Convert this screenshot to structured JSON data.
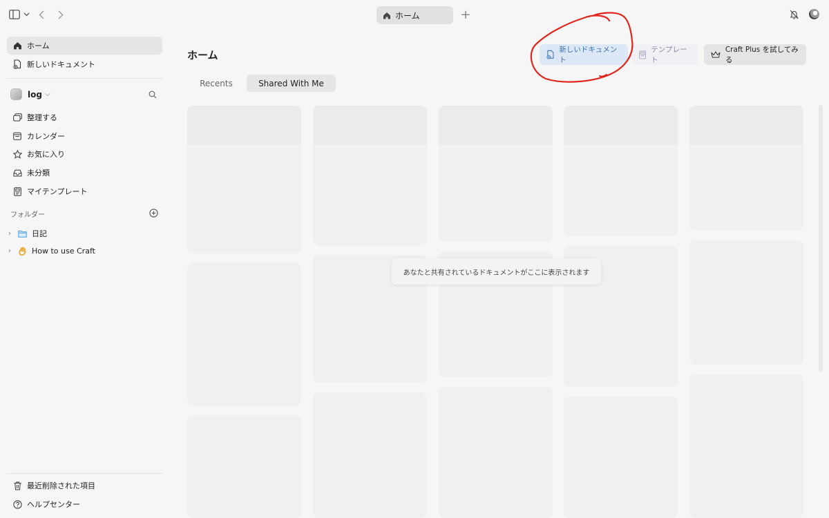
{
  "topbar": {
    "tab_label": "ホーム",
    "icons": [
      "sidebar-toggle-icon",
      "chevron-down-icon",
      "back-arrow-icon",
      "forward-arrow-icon",
      "house-icon",
      "plus-icon",
      "bell-slash-icon",
      "avatar"
    ]
  },
  "sidebar": {
    "top_items": [
      {
        "label": "ホーム",
        "icon": "house-icon",
        "active": true
      },
      {
        "label": "新しいドキュメント",
        "icon": "new-document-icon"
      }
    ],
    "workspace": {
      "name": "log"
    },
    "nav_items": [
      {
        "label": "整理する",
        "icon": "organize-icon"
      },
      {
        "label": "カレンダー",
        "icon": "calendar-icon"
      },
      {
        "label": "お気に入り",
        "icon": "star-icon"
      },
      {
        "label": "未分類",
        "icon": "inbox-icon"
      },
      {
        "label": "マイテンプレート",
        "icon": "template-icon"
      }
    ],
    "folders_label": "フォルダー",
    "folders": [
      {
        "label": "日記",
        "icon": "folder-icon"
      },
      {
        "label": "How to use Craft",
        "icon": "waving-hand-icon"
      }
    ],
    "bottom_items": [
      {
        "label": "最近削除された項目",
        "icon": "trash-icon"
      },
      {
        "label": "ヘルプセンター",
        "icon": "help-icon"
      }
    ]
  },
  "main": {
    "title": "ホーム",
    "buttons": {
      "new_document": "新しいドキュメント",
      "templates": "テンプレート",
      "craft_plus": "Craft Plus を試してみる"
    },
    "tabs": [
      {
        "label": "Recents",
        "active": false
      },
      {
        "label": "Shared With Me",
        "active": true
      }
    ],
    "empty_message": "あなたと共有されているドキュメントがここに表示されます"
  },
  "colors": {
    "accent_blue": "#3b6fb0",
    "annotation_red": "#e0261b",
    "background": "#f6f6f7"
  }
}
